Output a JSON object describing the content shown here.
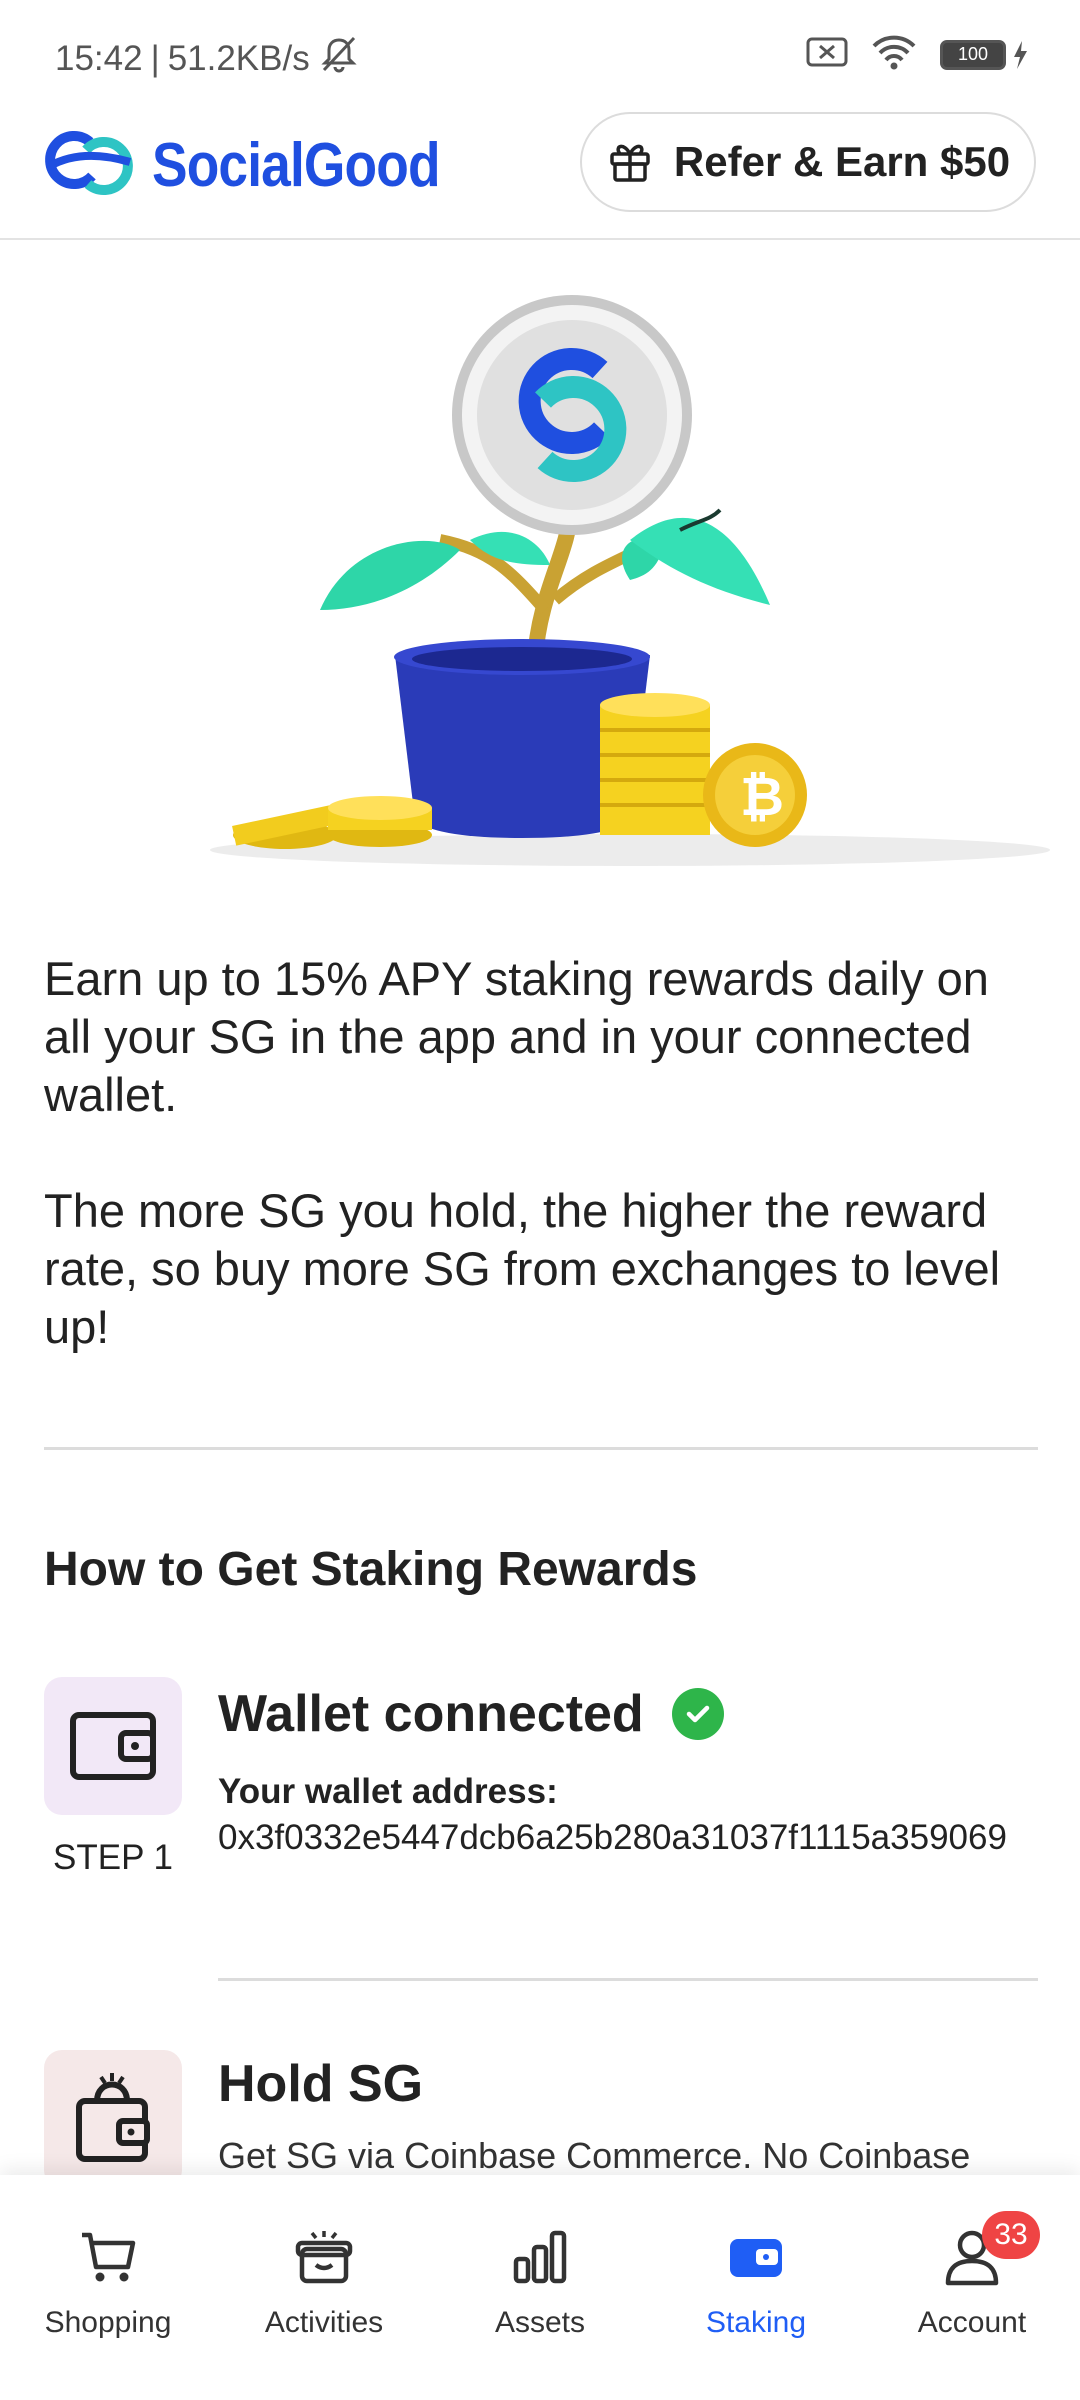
{
  "status_bar": {
    "time": "15:42",
    "separator": "|",
    "speed": "51.2KB/s",
    "battery": "100"
  },
  "header": {
    "brand": "SocialGood",
    "refer_label": "Refer & Earn $50"
  },
  "intro": {
    "paragraph1": "Earn up to 15% APY staking rewards daily on all your SG in the app and in your connected wallet.",
    "paragraph2": "The more SG you hold, the higher the reward rate, so buy more SG from exchanges to level up!"
  },
  "section_title": "How to Get Staking Rewards",
  "steps": [
    {
      "label": "STEP 1",
      "title": "Wallet connected",
      "wallet_label": "Your wallet address:",
      "wallet_address": "0x3f0332e5447dcb6a25b280a31037f1115a359069"
    },
    {
      "title": "Hold SG",
      "description": "Get SG via Coinbase Commerce. No Coinbase"
    }
  ],
  "nav": {
    "items": [
      {
        "label": "Shopping",
        "icon": "cart-icon"
      },
      {
        "label": "Activities",
        "icon": "gift-box-icon"
      },
      {
        "label": "Assets",
        "icon": "bar-chart-icon"
      },
      {
        "label": "Staking",
        "icon": "wallet-icon",
        "active": true
      },
      {
        "label": "Account",
        "icon": "person-icon",
        "badge": "33"
      }
    ]
  },
  "colors": {
    "brand_blue": "#1f4fe0",
    "active_nav": "#1f5ef5",
    "check_green": "#2eb54a",
    "badge_red": "#ef4444"
  }
}
